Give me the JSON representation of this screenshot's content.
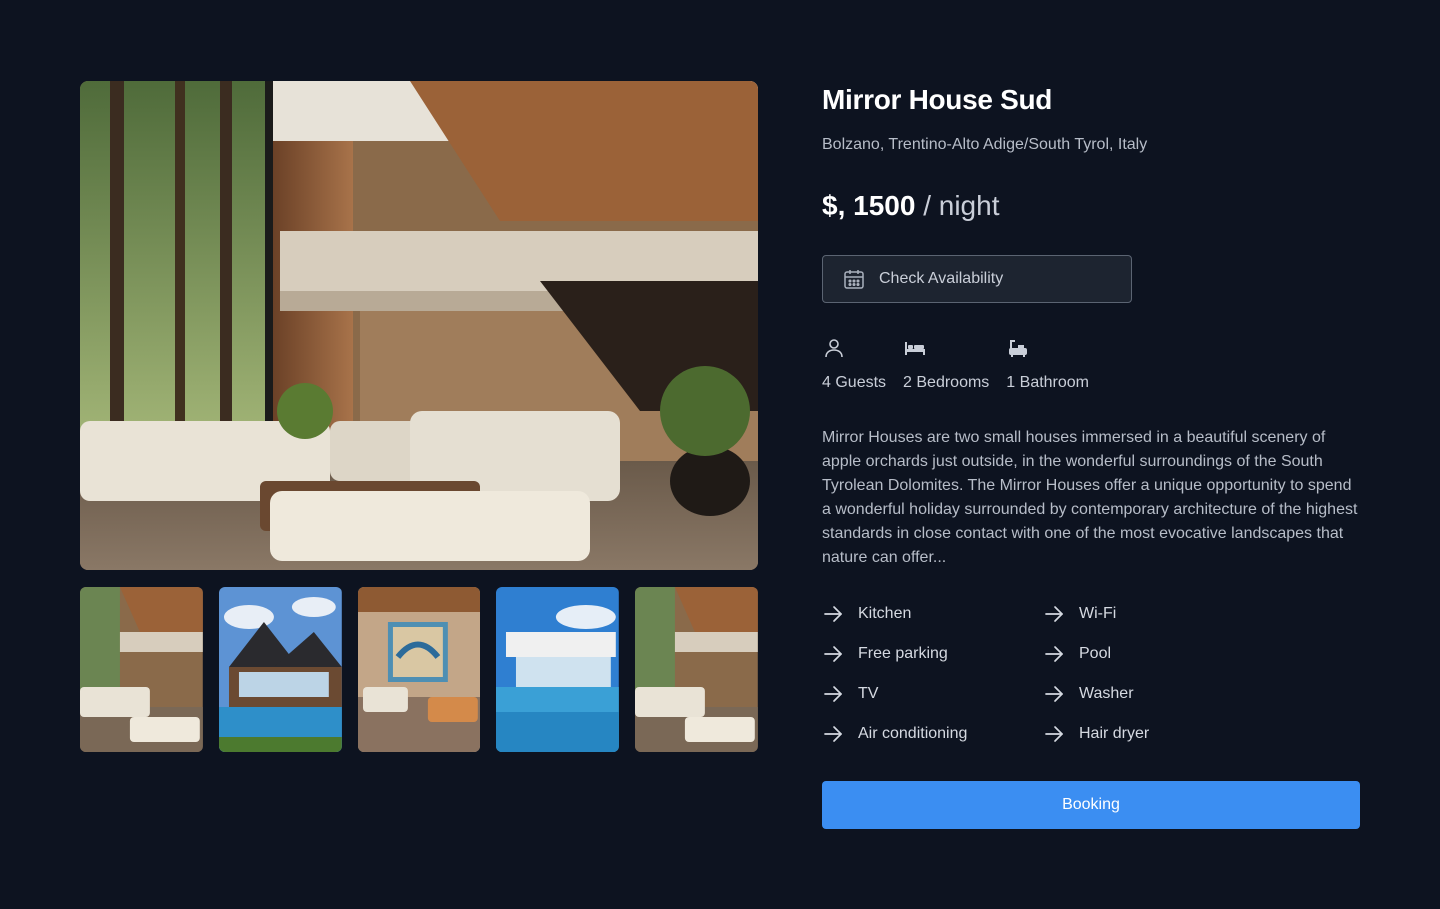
{
  "listing": {
    "title": "Mirror House Sud",
    "location": "Bolzano, Trentino-Alto Adige/South Tyrol, Italy",
    "price_amount": "$, 1500",
    "price_unit": "/ night"
  },
  "availability": {
    "label": "Check Availability",
    "icon": "calendar-icon"
  },
  "specs": [
    {
      "icon": "user-icon",
      "label": "4 Guests"
    },
    {
      "icon": "bed-icon",
      "label": "2 Bedrooms"
    },
    {
      "icon": "bathtub-icon",
      "label": "1 Bathroom"
    }
  ],
  "description": "Mirror Houses are two small houses immersed in a beautiful scenery of apple orchards just outside, in the wonderful surroundings of the South Tyrolean Dolomites. The Mirror Houses offer a unique opportunity to spend a wonderful holiday surrounded by contemporary architecture of the highest standards in close contact with one of the most evocative landscapes that nature can offer...",
  "amenities": [
    "Kitchen",
    "Wi-Fi",
    "Free parking",
    "Pool",
    "TV",
    "Washer",
    "Air conditioning",
    "Hair dryer"
  ],
  "booking": {
    "label": "Booking"
  },
  "colors": {
    "background": "#0d1320",
    "accent": "#3b8ef2",
    "text": "#e6e9ef"
  }
}
